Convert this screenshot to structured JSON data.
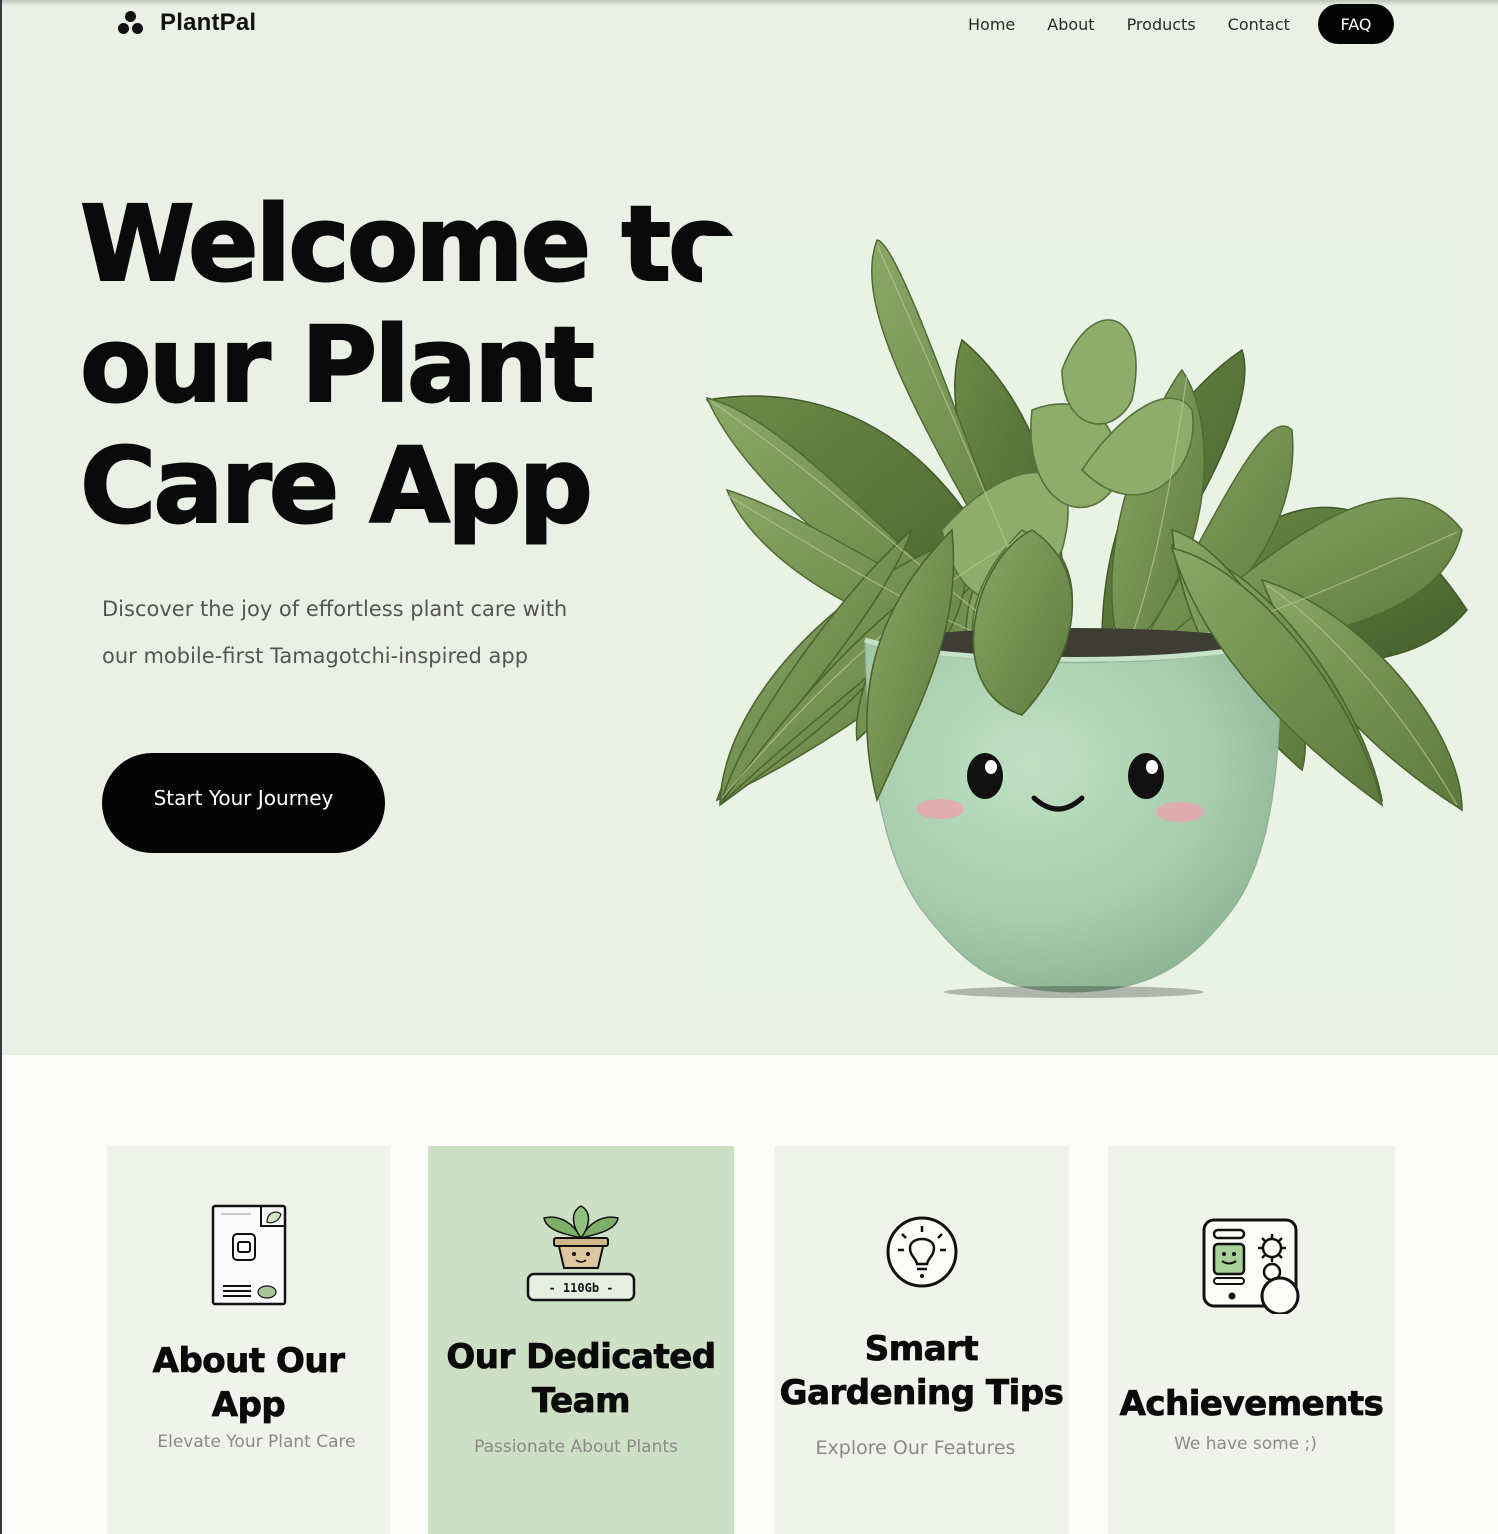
{
  "brand": {
    "name": "PlantPal"
  },
  "nav": {
    "links": [
      "Home",
      "About",
      "Products",
      "Contact"
    ],
    "faq_label": "FAQ"
  },
  "hero": {
    "title_lines": [
      "Welcome to",
      "our Plant",
      "Care App"
    ],
    "subtitle_lines": [
      "Discover the joy of effortless plant care with",
      "our mobile-first Tamagotchi-inspired app"
    ],
    "cta_label": "Start Your Journey"
  },
  "features": {
    "cards": [
      {
        "title_lines": [
          "About Our",
          "App"
        ],
        "subtitle": "Elevate Your Plant Care",
        "icon": "phone-app-icon"
      },
      {
        "title_lines": [
          "Our Dedicated",
          "Team"
        ],
        "subtitle": "Passionate About Plants",
        "icon": "potted-plant-icon",
        "highlighted": true
      },
      {
        "title_lines": [
          "Smart",
          "Gardening Tips"
        ],
        "subtitle": "Explore Our Features",
        "icon": "lightbulb-icon"
      },
      {
        "title_lines": [
          "Achievements"
        ],
        "subtitle": "We have some ;)",
        "icon": "tablet-trophy-icon"
      }
    ]
  },
  "colors": {
    "hero_bg": "#ebf0e6",
    "accent_dark": "#050505",
    "card_bg": "#f0f3ec",
    "card_highlight_bg": "#cde0c5",
    "leaf": "#6f8d4c",
    "pot": "#a8cfae"
  }
}
